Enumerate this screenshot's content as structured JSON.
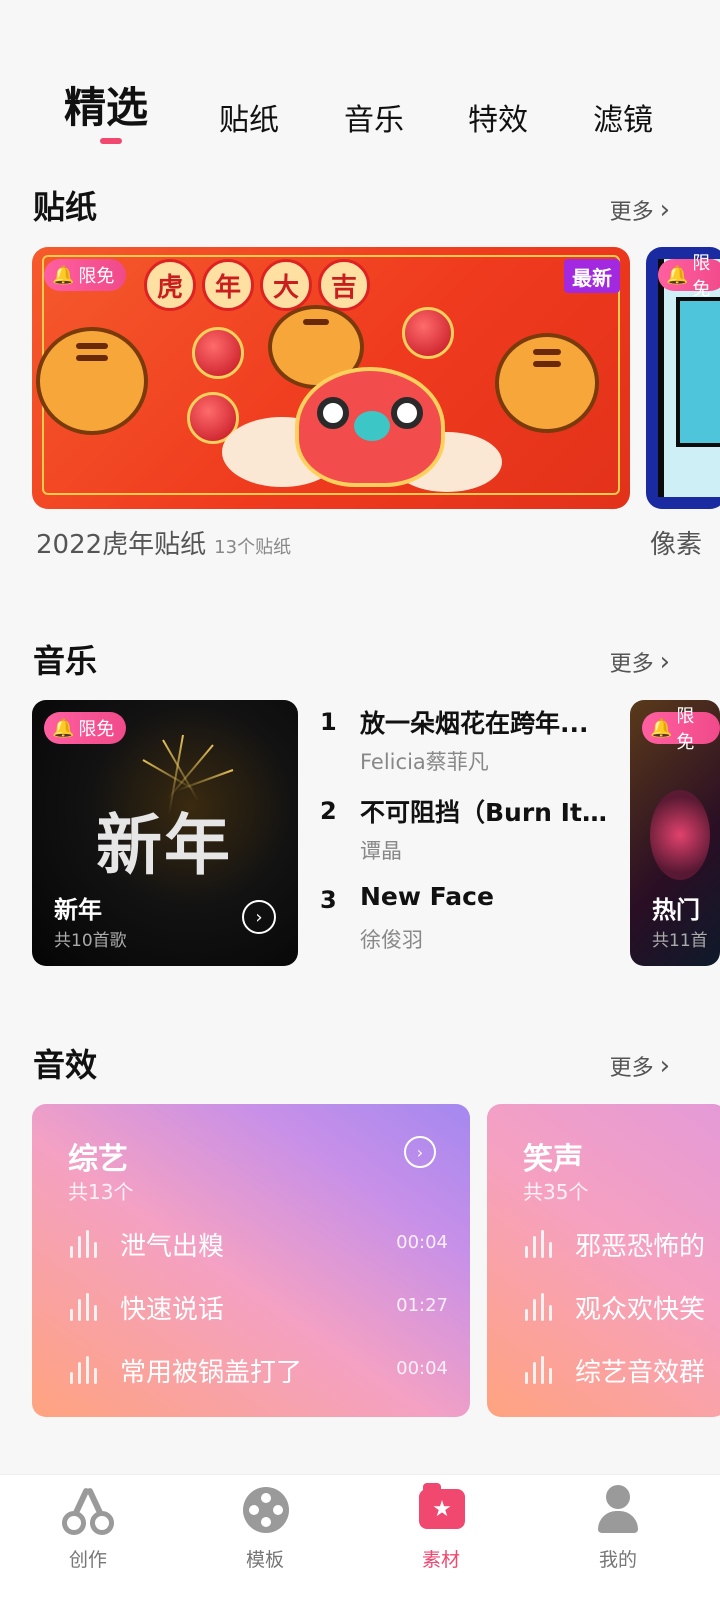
{
  "top_tabs": [
    "精选",
    "贴纸",
    "音乐",
    "特效",
    "滤镜"
  ],
  "active_tab": "精选",
  "more_label": "更多",
  "stickers": {
    "title": "贴纸",
    "cards": [
      {
        "name": "2022虎年贴纸",
        "count": "13个贴纸",
        "badge": "限免",
        "tag": "最新",
        "art_text": [
          "虎",
          "年",
          "大",
          "吉"
        ]
      },
      {
        "name": "像素",
        "badge": "限免"
      }
    ]
  },
  "music": {
    "title": "音乐",
    "albums": [
      {
        "title": "新年",
        "cover_text": "新年",
        "count": "共10首歌",
        "badge": "限免"
      },
      {
        "title": "热门",
        "count": "共11首",
        "badge": "限免"
      }
    ],
    "songs": [
      {
        "rank": "1",
        "title": "放一朵烟花在跨年...",
        "artist": "Felicia蔡菲凡"
      },
      {
        "rank": "2",
        "title": "不可阻挡（Burn It ...",
        "artist": "谭晶"
      },
      {
        "rank": "3",
        "title": "New Face",
        "artist": "徐俊羽"
      }
    ]
  },
  "sound_effects": {
    "title": "音效",
    "cards": [
      {
        "category": "综艺",
        "count": "共13个",
        "items": [
          {
            "name": "泄气出糗",
            "duration": "00:04"
          },
          {
            "name": "快速说话",
            "duration": "01:27"
          },
          {
            "name": "常用被锅盖打了",
            "duration": "00:04"
          }
        ]
      },
      {
        "category": "笑声",
        "count": "共35个",
        "items": [
          {
            "name": "邪恶恐怖的"
          },
          {
            "name": "观众欢快笑"
          },
          {
            "name": "综艺音效群"
          }
        ]
      }
    ]
  },
  "bottom_nav": [
    {
      "label": "创作",
      "icon": "scissors-icon"
    },
    {
      "label": "模板",
      "icon": "film-reel-icon"
    },
    {
      "label": "素材",
      "icon": "material-folder-icon",
      "active": true
    },
    {
      "label": "我的",
      "icon": "user-icon"
    }
  ],
  "colors": {
    "accent": "#f0486f",
    "badge_new": "#a229e0"
  }
}
